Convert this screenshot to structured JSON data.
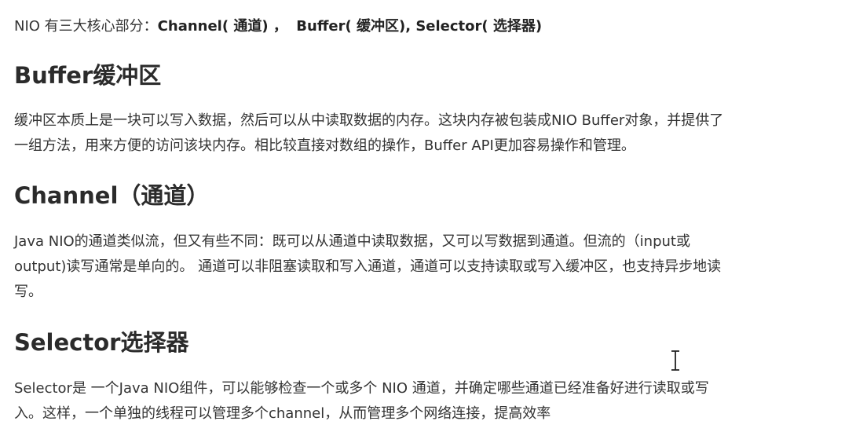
{
  "intro": {
    "prefix": "NIO 有三大核心部分：",
    "channel": "Channel( 通道) ，",
    "buffer": "Buffer( 缓冲区), ",
    "selector": "Selector( 选择器)"
  },
  "sections": {
    "buffer": {
      "heading": "Buffer缓冲区",
      "lines": [
        "缓冲区本质上是一块可以写入数据，然后可以从中读取数据的内存。这块内存被包装成NIO Buffer对象，并提供了",
        "一组方法，用来方便的访问该块内存。相比较直接对数组的操作，Buffer API更加容易操作和管理。"
      ]
    },
    "channel": {
      "heading": "Channel（通道）",
      "lines": [
        "Java NIO的通道类似流，但又有些不同：既可以从通道中读取数据，又可以写数据到通道。但流的（input或",
        "output)读写通常是单向的。 通道可以非阻塞读取和写入通道，通道可以支持读取或写入缓冲区，也支持异步地读",
        "写。"
      ]
    },
    "selector": {
      "heading": "Selector选择器",
      "lines": [
        "Selector是 一个Java NIO组件，可以能够检查一个或多个 NIO 通道，并确定哪些通道已经准备好进行读取或写",
        "入。这样，一个单独的线程可以管理多个channel，从而管理多个网络连接，提高效率"
      ]
    }
  }
}
